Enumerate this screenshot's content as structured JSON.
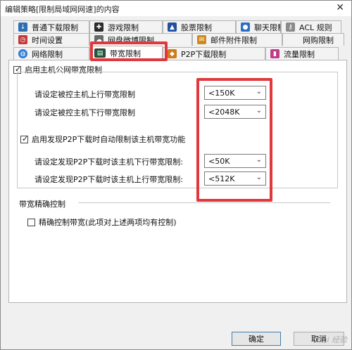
{
  "window": {
    "title": "编辑策略[限制局域网网速]的内容",
    "close_glyph": "✕"
  },
  "tabs_row1": [
    {
      "label": "普通下载限制",
      "icon": "download-icon",
      "color": "#2f6fb0"
    },
    {
      "label": "游戏限制",
      "icon": "gamepad-icon",
      "color": "#2b2b2b"
    },
    {
      "label": "股票限制",
      "icon": "stock-chart-icon",
      "color": "#2050a0"
    },
    {
      "label": "聊天限制",
      "icon": "chat-icon",
      "color": "#2a6fc4"
    },
    {
      "label": "ACL 规则",
      "icon": "acl-key-icon",
      "color": "#8a8a8a"
    }
  ],
  "tabs_row2": [
    {
      "label": "时间设置",
      "icon": "clock-icon",
      "color": "#c23a3a"
    },
    {
      "label": "网盘微博限制",
      "icon": "cloud-icon",
      "color": "#6a6a6a"
    },
    {
      "label": "邮件附件限制",
      "icon": "mail-icon",
      "color": "#d08a20"
    },
    {
      "label": "网购限制",
      "icon": "shopping-icon",
      "color": "#999999"
    }
  ],
  "tabs_row3": [
    {
      "label": "网络限制",
      "icon": "globe-icon",
      "color": "#2c7bd6"
    },
    {
      "label": "带宽限制",
      "icon": "bandwidth-monitor-icon",
      "color": "#1c5a3a",
      "selected": true
    },
    {
      "label": "P2P下载限制",
      "icon": "p2p-icon",
      "color": "#d07a1a"
    },
    {
      "label": "流量限制",
      "icon": "traffic-bars-icon",
      "color": "#c23a8a"
    }
  ],
  "panel": {
    "enable_public_bw": {
      "label": "启用主机公网带宽限制",
      "checked": true
    },
    "upload_label": "请设定被控主机上行带宽限制",
    "upload_value": "<150K",
    "download_label": "请设定被控主机下行带宽限制",
    "download_value": "<2048K",
    "enable_p2p_auto": {
      "label": "启用发现P2P下载时自动限制该主机带宽功能",
      "checked": true
    },
    "p2p_down_label": "请设定发现P2P下载时该主机下行带宽限制:",
    "p2p_down_value": "<50K",
    "p2p_up_label": "请设定发现P2P下载时该主机上行带宽限制:",
    "p2p_up_value": "<512K",
    "precise_section": "带宽精确控制",
    "precise_checkbox": {
      "label": "精确控制带宽(此项对上述两项均有控制)",
      "checked": false
    }
  },
  "buttons": {
    "ok": "确定",
    "cancel": "取消"
  },
  "watermark": "Bai 经验",
  "colors": {
    "highlight": "#e0383c"
  }
}
